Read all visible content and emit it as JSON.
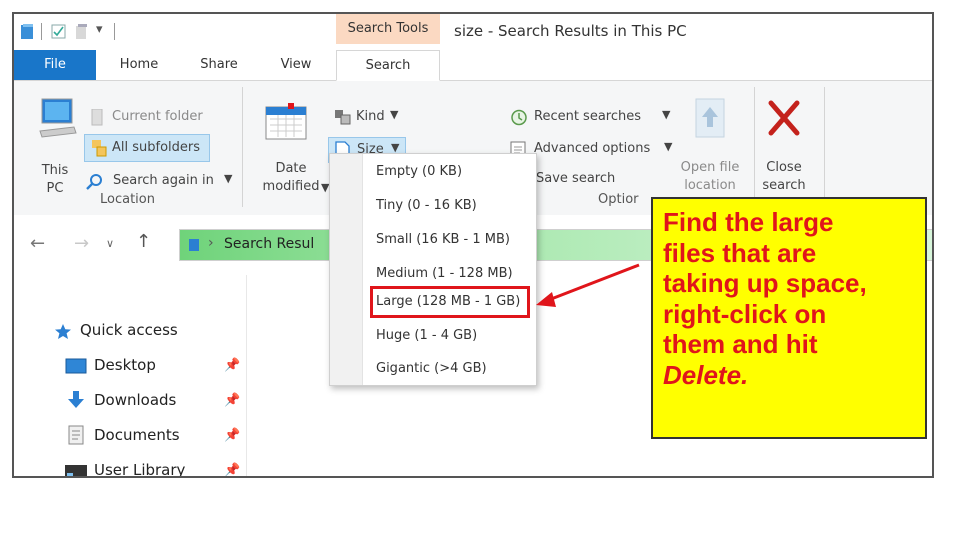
{
  "window": {
    "title": "size - Search Results in This PC",
    "contextual_tab_group": "Search Tools"
  },
  "tabs": [
    {
      "label": "File"
    },
    {
      "label": "Home"
    },
    {
      "label": "Share"
    },
    {
      "label": "View"
    },
    {
      "label": "Search"
    }
  ],
  "ribbon": {
    "location": {
      "this_pc_line1": "This",
      "this_pc_line2": "PC",
      "current_folder": "Current folder",
      "all_subfolders": "All subfolders",
      "search_again": "Search again in",
      "group_label": "Location"
    },
    "refine": {
      "date_line1": "Date",
      "date_line2": "modified",
      "kind": "Kind",
      "size": "Size"
    },
    "options": {
      "recent_searches": "Recent searches",
      "advanced_options": "Advanced options",
      "save_search": "Save search",
      "group_label": "Optior",
      "open_file_line1": "Open file",
      "open_file_line2": "location",
      "close_line1": "Close",
      "close_line2": "search"
    }
  },
  "size_menu": {
    "items": [
      {
        "label": "Empty (0 KB)"
      },
      {
        "label": "Tiny (0 - 16 KB)"
      },
      {
        "label": "Small (16 KB - 1 MB)"
      },
      {
        "label": "Medium (1 - 128 MB)"
      },
      {
        "label": "Large (128 MB - 1 GB)"
      },
      {
        "label": "Huge (1 - 4 GB)"
      },
      {
        "label": "Gigantic (>4 GB)"
      }
    ]
  },
  "address_bar": {
    "path": "Search Resul"
  },
  "navigation": {
    "items": [
      {
        "label": "Quick access"
      },
      {
        "label": "Desktop"
      },
      {
        "label": "Downloads"
      },
      {
        "label": "Documents"
      },
      {
        "label": "User Library"
      }
    ]
  },
  "callout": {
    "line1": "Find the large",
    "line2": "files that are",
    "line3": "taking up space,",
    "line4": "right-click on",
    "line5": "them and hit",
    "line6": "Delete."
  },
  "colors": {
    "accent_blue": "#1976c9",
    "search_tools_band": "#fbd9c2",
    "highlight_red": "#e0151b",
    "callout_yellow": "#ffff00"
  }
}
